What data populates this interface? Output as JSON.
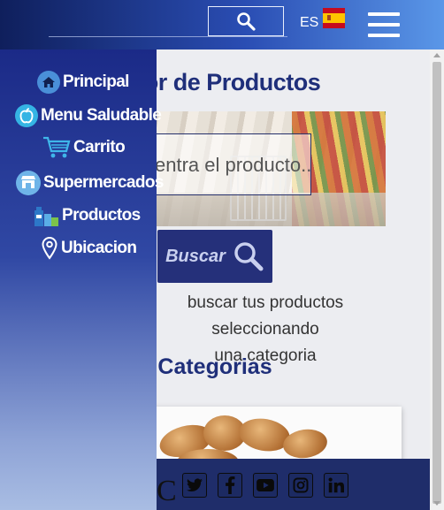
{
  "header": {
    "search_icon": "search-icon",
    "language": "ES",
    "flag": "spain-flag-icon",
    "menu_icon": "hamburger-menu-icon"
  },
  "main": {
    "title": "cador de Productos",
    "search_placeholder": "entra el producto...",
    "search_button": "Buscar",
    "hint_line1": "buscar tus productos seleccionando",
    "hint_line2": "una categoria",
    "categories_title": "Categorias"
  },
  "sidebar": {
    "items": [
      {
        "label": "Principal",
        "icon": "home-icon"
      },
      {
        "label": "Menu Saludable",
        "icon": "apple-icon"
      },
      {
        "label": "Carrito",
        "icon": "cart-icon"
      },
      {
        "label": "Supermercados",
        "icon": "store-icon"
      },
      {
        "label": "Productos",
        "icon": "products-icon"
      },
      {
        "label": "Ubicacion",
        "icon": "location-pin-icon"
      }
    ]
  },
  "footer": {
    "partial_letter": "C",
    "social": [
      "twitter-icon",
      "facebook-icon",
      "youtube-icon",
      "instagram-icon",
      "linkedin-icon"
    ]
  },
  "colors": {
    "primary": "#1f2f7a",
    "header_start": "#0f1f5c",
    "header_end": "#5a97e8",
    "button": "#25307a",
    "footer": "#1f2d6a"
  }
}
